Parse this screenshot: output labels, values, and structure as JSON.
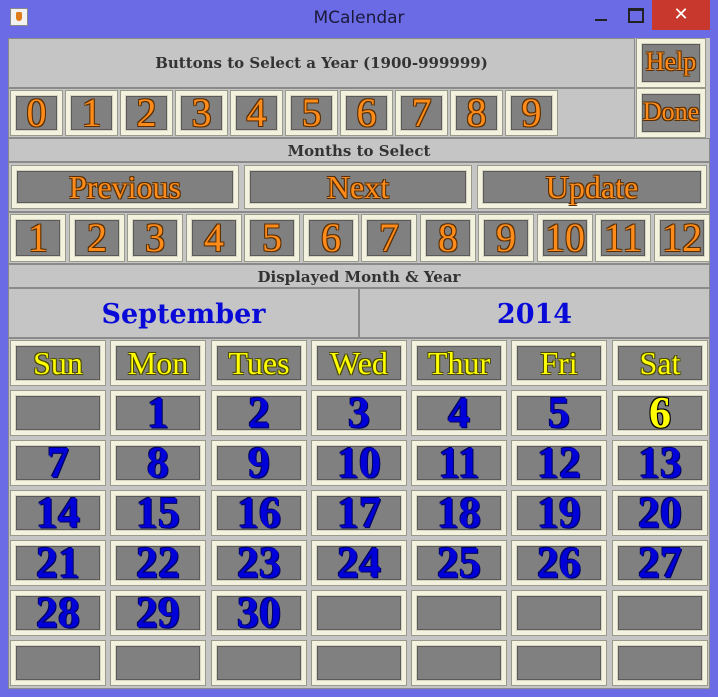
{
  "window": {
    "title": "MCalendar",
    "icon": "java-cup-icon"
  },
  "year_header": "Buttons to Select a Year (1900-999999)",
  "help_label": "Help",
  "done_label": "Done",
  "digits": [
    "0",
    "1",
    "2",
    "3",
    "4",
    "5",
    "6",
    "7",
    "8",
    "9"
  ],
  "months_header": "Months to Select",
  "nav": {
    "previous": "Previous",
    "next": "Next",
    "update": "Update"
  },
  "months": [
    "1",
    "2",
    "3",
    "4",
    "5",
    "6",
    "7",
    "8",
    "9",
    "10",
    "11",
    "12"
  ],
  "displayed_header": "Displayed Month & Year",
  "display": {
    "month": "September",
    "year": "2014"
  },
  "weekdays": [
    "Sun",
    "Mon",
    "Tues",
    "Wed",
    "Thur",
    "Fri",
    "Sat"
  ],
  "days": [
    "",
    "1",
    "2",
    "3",
    "4",
    "5",
    "6",
    "7",
    "8",
    "9",
    "10",
    "11",
    "12",
    "13",
    "14",
    "15",
    "16",
    "17",
    "18",
    "19",
    "20",
    "21",
    "22",
    "23",
    "24",
    "25",
    "26",
    "27",
    "28",
    "29",
    "30",
    "",
    "",
    "",
    "",
    "",
    "",
    "",
    "",
    "",
    "",
    ""
  ],
  "colors": {
    "orange": "#ff8c1a",
    "blue": "#0000d8",
    "yellow": "#ffff00",
    "titlebar": "#6b6be6",
    "close": "#c8382d"
  }
}
